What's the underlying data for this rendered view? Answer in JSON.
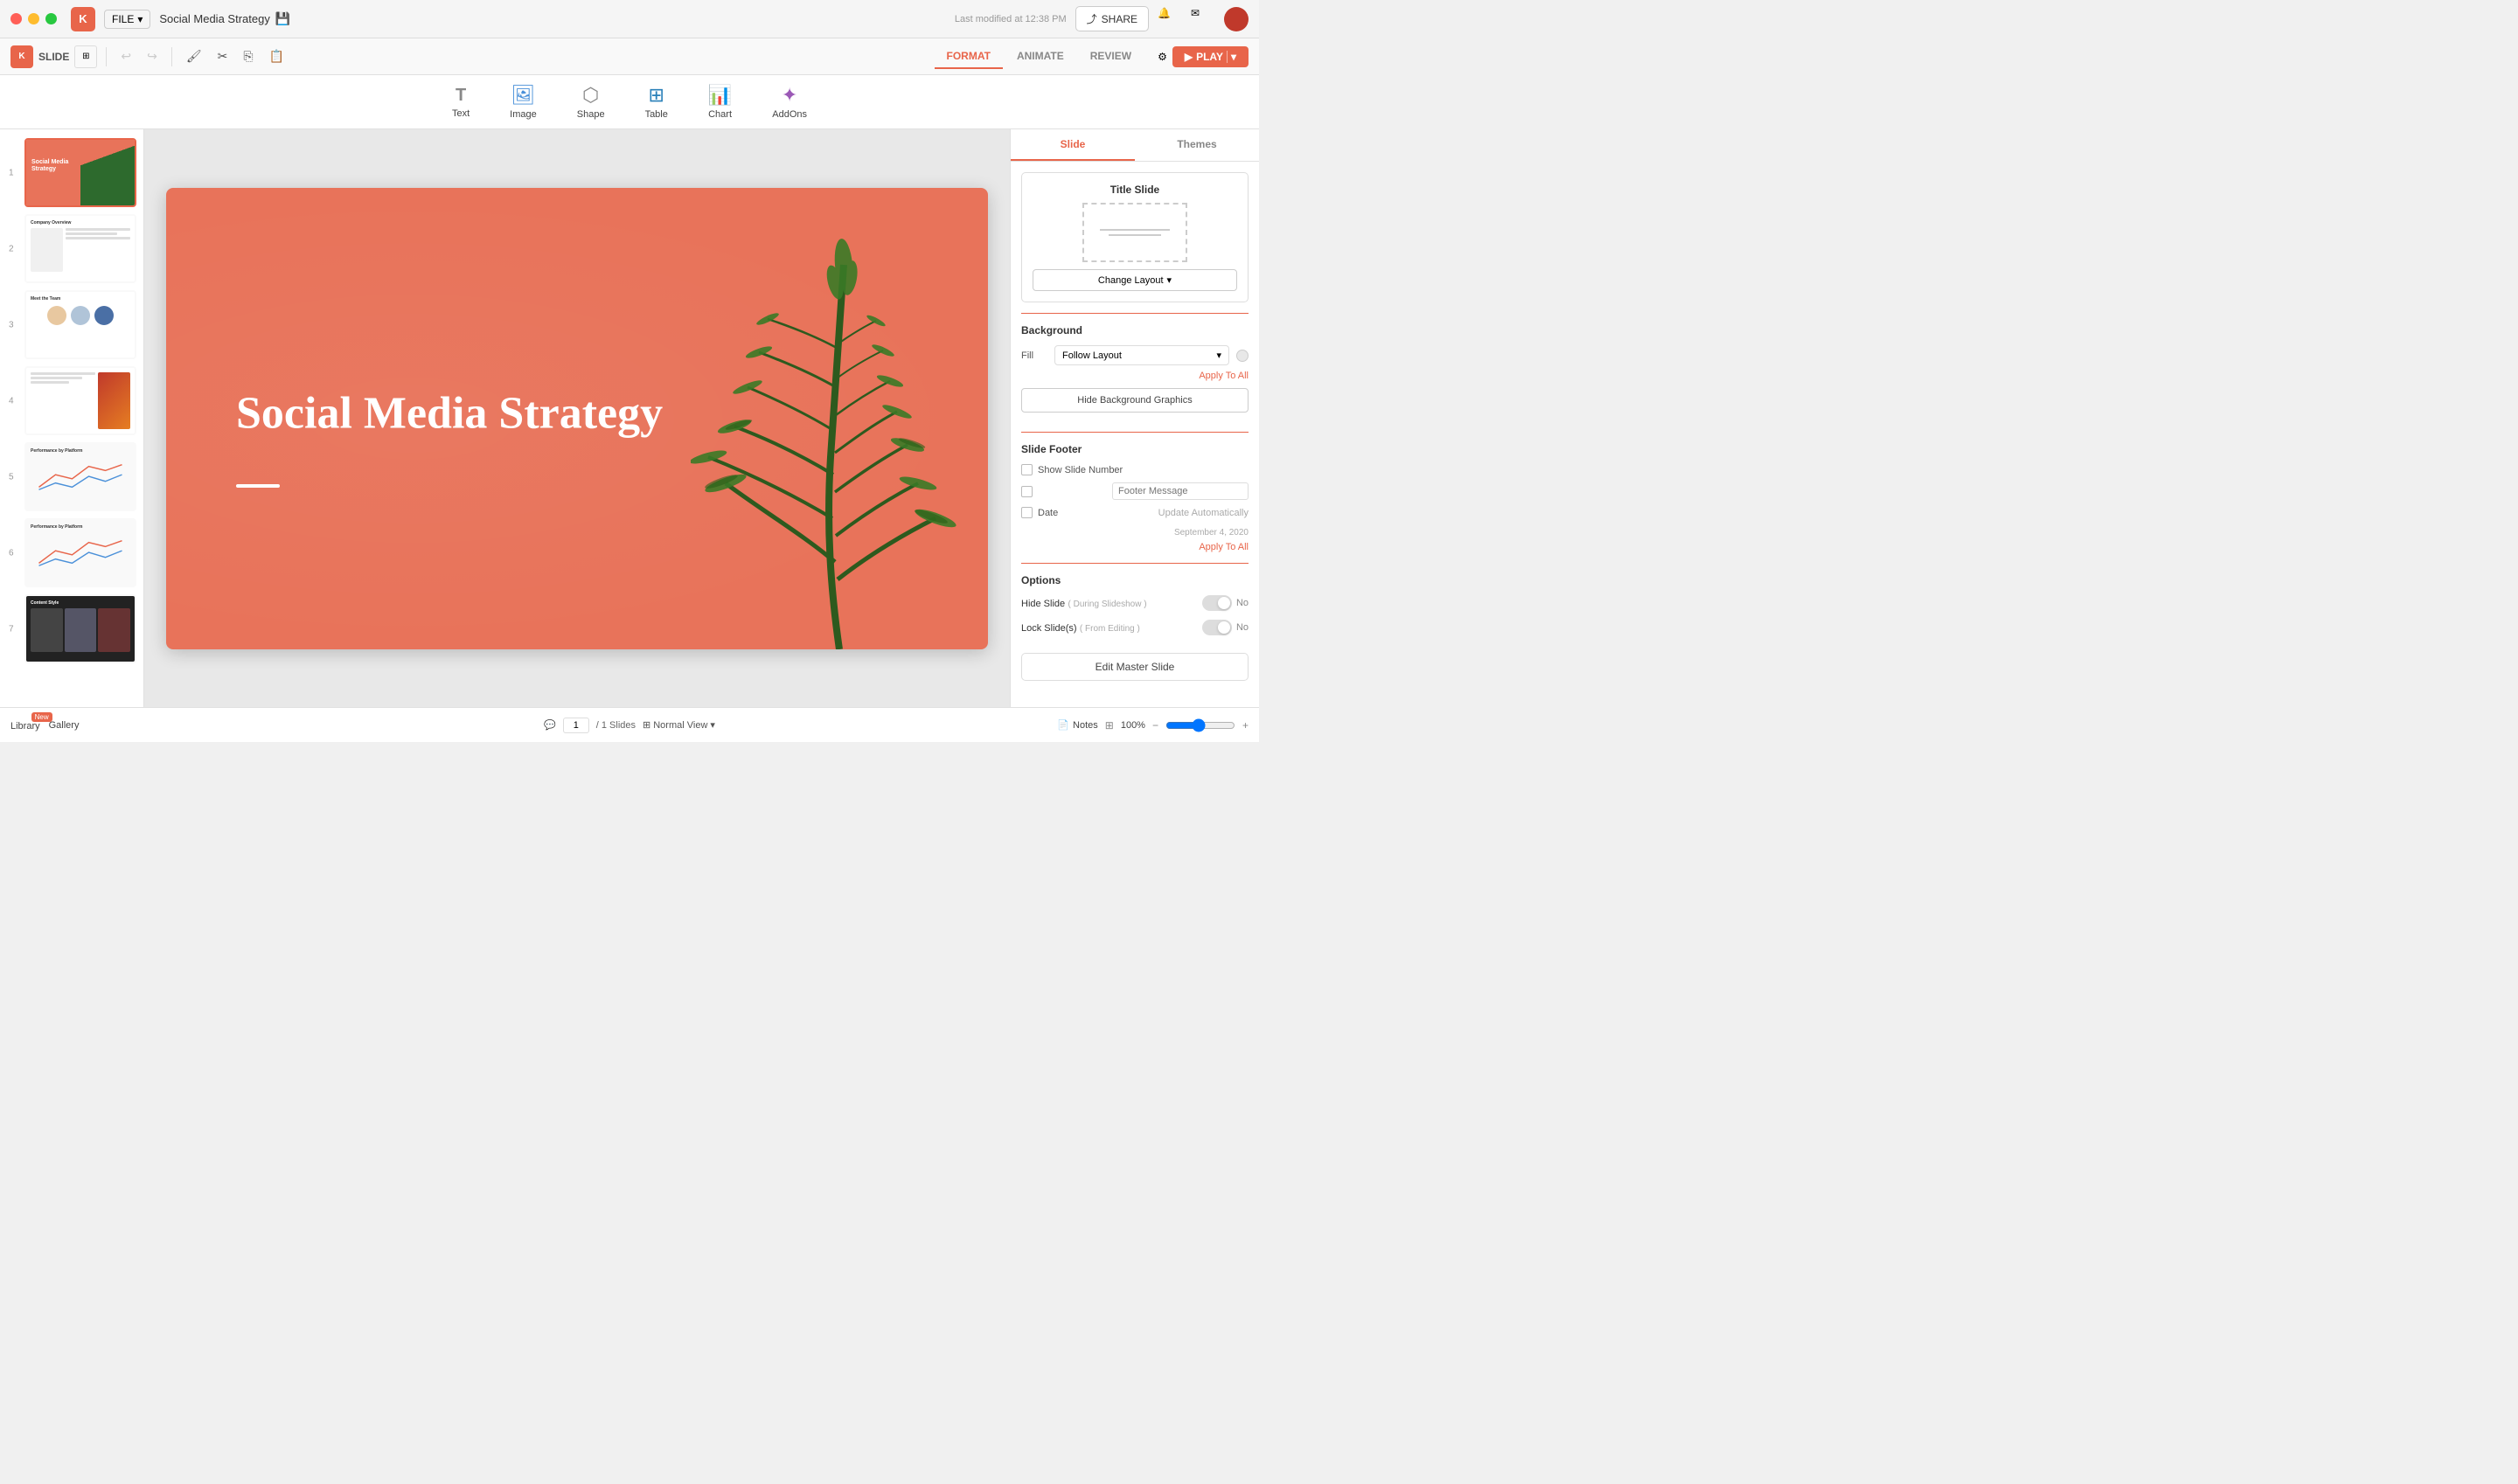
{
  "window": {
    "title": "Social Media Strategy",
    "last_modified": "Last modified at 12:38 PM"
  },
  "traffic_lights": {
    "red": "close",
    "yellow": "minimize",
    "green": "maximize"
  },
  "top_menu": {
    "file_label": "FILE",
    "slide_label": "SLIDE"
  },
  "insert_tools": [
    {
      "id": "text",
      "label": "Text",
      "icon": "T"
    },
    {
      "id": "image",
      "label": "Image",
      "icon": "🖼"
    },
    {
      "id": "shape",
      "label": "Shape",
      "icon": "⬡"
    },
    {
      "id": "table",
      "label": "Table",
      "icon": "⊞"
    },
    {
      "id": "chart",
      "label": "Chart",
      "icon": "📊"
    },
    {
      "id": "addons",
      "label": "AddOns",
      "icon": "✦"
    }
  ],
  "header": {
    "format_label": "FORMAT",
    "animate_label": "ANIMATE",
    "review_label": "REVIEW",
    "play_label": "PLAY",
    "share_label": "SHARE"
  },
  "format_panel": {
    "slide_tab": "Slide",
    "themes_tab": "Themes",
    "layout_title": "Title Slide",
    "change_layout_label": "Change Layout",
    "background_label": "Background",
    "fill_label": "Fill",
    "follow_layout_label": "Follow Layout",
    "apply_to_all_label": "Apply To All",
    "hide_bg_graphics_label": "Hide Background Graphics",
    "footer_label": "Slide Footer",
    "show_slide_number_label": "Show Slide Number",
    "footer_message_label": "Footer Message",
    "date_label": "Date",
    "update_automatically_label": "Update Automatically",
    "date_value": "September 4, 2020",
    "apply_to_all_footer_label": "Apply To All",
    "options_label": "Options",
    "hide_slide_label": "Hide Slide",
    "hide_slide_sublabel": "( During Slideshow )",
    "no_label": "No",
    "lock_slide_label": "Lock Slide(s)",
    "lock_slide_sublabel": "( From Editing )",
    "edit_master_label": "Edit Master Slide"
  },
  "slide_panel": {
    "slides": [
      {
        "num": 1,
        "active": true
      },
      {
        "num": 2,
        "active": false
      },
      {
        "num": 3,
        "active": false
      },
      {
        "num": 4,
        "active": false
      },
      {
        "num": 5,
        "active": false
      },
      {
        "num": 6,
        "active": false
      },
      {
        "num": 7,
        "active": false
      }
    ]
  },
  "canvas": {
    "title": "Social Media Strategy"
  },
  "bottom_bar": {
    "library_label": "Library",
    "new_badge": "New",
    "gallery_label": "Gallery",
    "page_current": "1",
    "page_total": "/ 1 Slides",
    "normal_view_label": "Normal View",
    "notes_label": "Notes",
    "zoom_level": "100%"
  },
  "toolbar_buttons": {
    "undo": "↩",
    "redo": "↪",
    "copy_style": "🖌",
    "cut": "✂",
    "copy": "⎘",
    "paste": "📋"
  }
}
